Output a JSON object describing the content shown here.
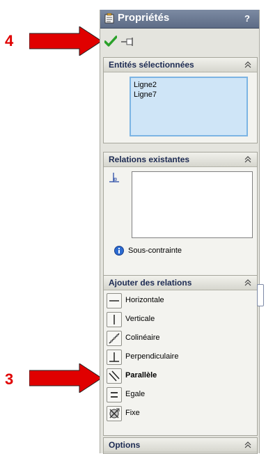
{
  "panel": {
    "title": "Propriétés",
    "help": "?"
  },
  "groups": {
    "selected": {
      "header": "Entités sélectionnées",
      "items": [
        "Ligne2",
        "Ligne7"
      ]
    },
    "existing": {
      "header": "Relations existantes",
      "status": "Sous-contrainte"
    },
    "add": {
      "header": "Ajouter des relations",
      "items": [
        "Horizontale",
        "Verticale",
        "Colinéaire",
        "Perpendiculaire",
        "Parallèle",
        "Egale",
        "Fixe"
      ]
    },
    "options": {
      "header": "Options"
    }
  },
  "annotations": {
    "arrow_top_number": "4",
    "arrow_bottom_number": "3"
  },
  "colors": {
    "arrow": "#e00000",
    "titlebar": "#6b7a93",
    "selection_box": "#cfe5f7",
    "ok_check": "#2aa12a"
  },
  "icons": {
    "ok": "check-icon",
    "pin": "pushpin-icon",
    "title": "properties-icon",
    "collapse": "double-chevron-up-icon",
    "info": "info-icon"
  }
}
